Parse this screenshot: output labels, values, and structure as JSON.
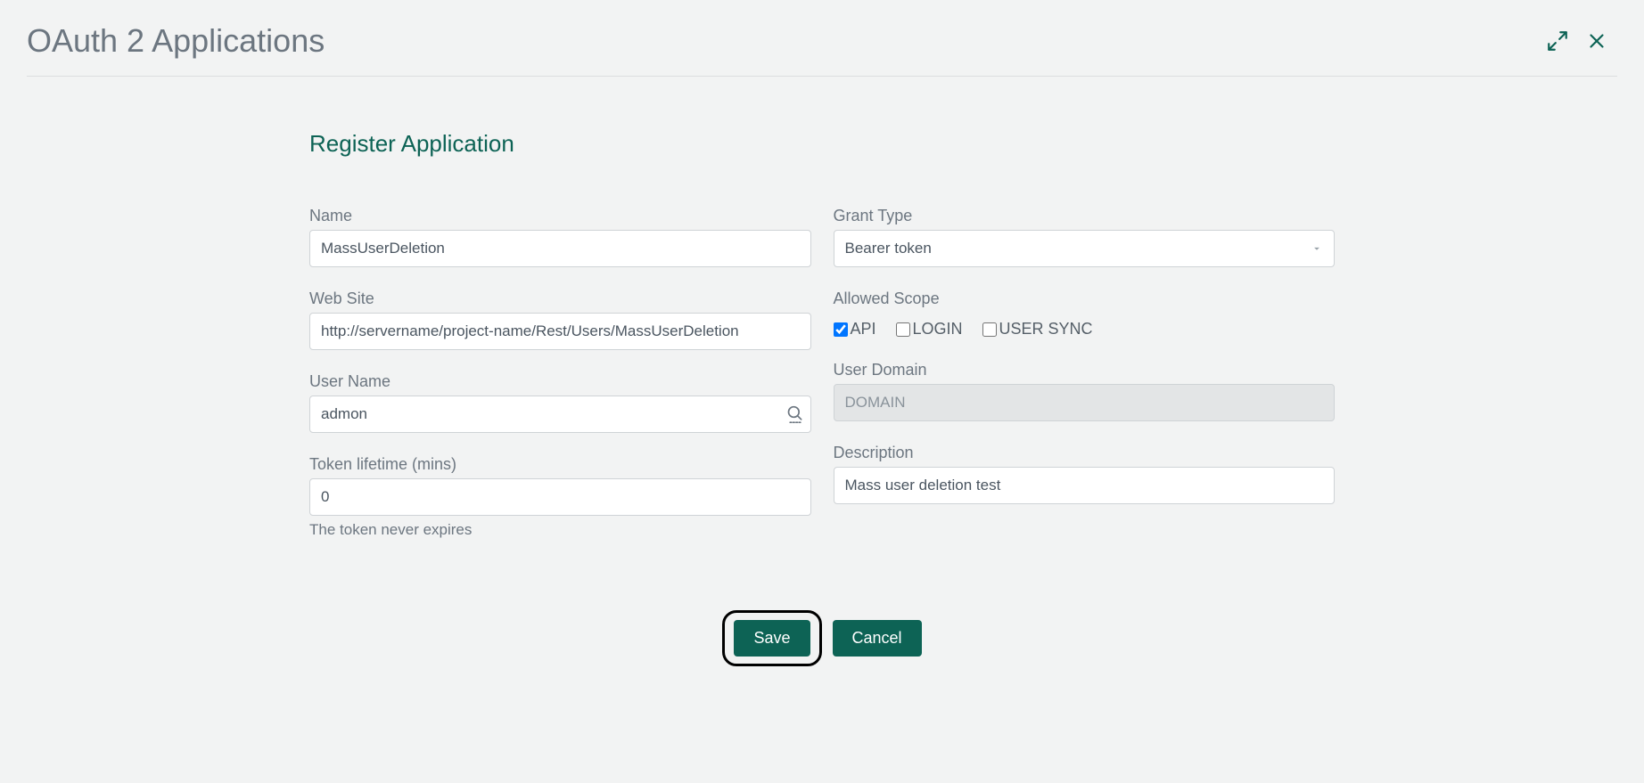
{
  "header": {
    "title": "OAuth 2 Applications"
  },
  "section": {
    "title": "Register Application"
  },
  "form": {
    "name": {
      "label": "Name",
      "value": "MassUserDeletion"
    },
    "grant_type": {
      "label": "Grant Type",
      "value": "Bearer token"
    },
    "web_site": {
      "label": "Web Site",
      "value": "http://servername/project-name/Rest/Users/MassUserDeletion"
    },
    "allowed_scope": {
      "label": "Allowed Scope",
      "options": {
        "api": {
          "label": "API",
          "checked": true
        },
        "login": {
          "label": "LOGIN",
          "checked": false
        },
        "user_sync": {
          "label": "USER SYNC",
          "checked": false
        }
      }
    },
    "user_name": {
      "label": "User Name",
      "value": "admon"
    },
    "user_domain": {
      "label": "User Domain",
      "value": "DOMAIN"
    },
    "token_lifetime": {
      "label": "Token lifetime (mins)",
      "value": "0",
      "helper": "The token never expires"
    },
    "description": {
      "label": "Description",
      "value": "Mass user deletion test"
    }
  },
  "buttons": {
    "save": "Save",
    "cancel": "Cancel"
  }
}
